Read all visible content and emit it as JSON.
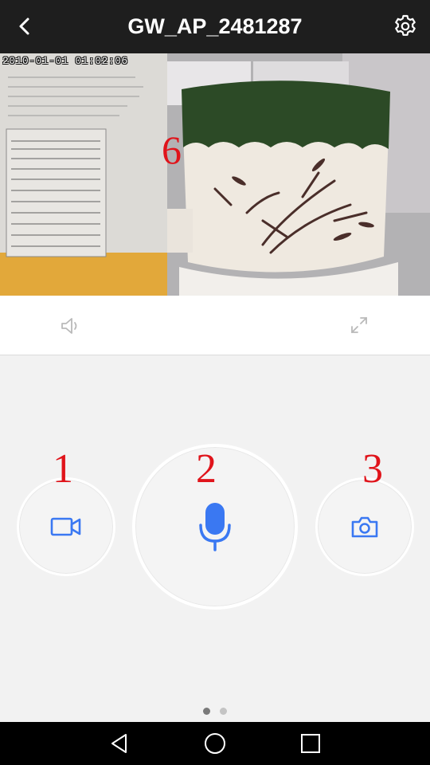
{
  "header": {
    "title": "GW_AP_2481287"
  },
  "video": {
    "timestamp": "2010-01-01 01:02:06",
    "overlay_number": "6"
  },
  "media_controls": {
    "speaker_icon": "speaker-icon",
    "fullscreen_icon": "fullscreen-icon"
  },
  "actions": {
    "record": {
      "number_label": "1",
      "icon": "video-camera-icon"
    },
    "talk": {
      "number_label": "2",
      "icon": "microphone-icon"
    },
    "snapshot": {
      "number_label": "3",
      "icon": "camera-icon"
    }
  },
  "pager": {
    "page_count": 2,
    "current_page": 1
  },
  "colors": {
    "topbar": "#1e1e1e",
    "accent_blue": "#3a78f2",
    "annotation_red": "#e0141b",
    "icon_gray": "#b9b9b9"
  },
  "system_nav": {
    "back_icon": "back-triangle-icon",
    "home_icon": "home-circle-icon",
    "recents_icon": "recents-square-icon"
  }
}
